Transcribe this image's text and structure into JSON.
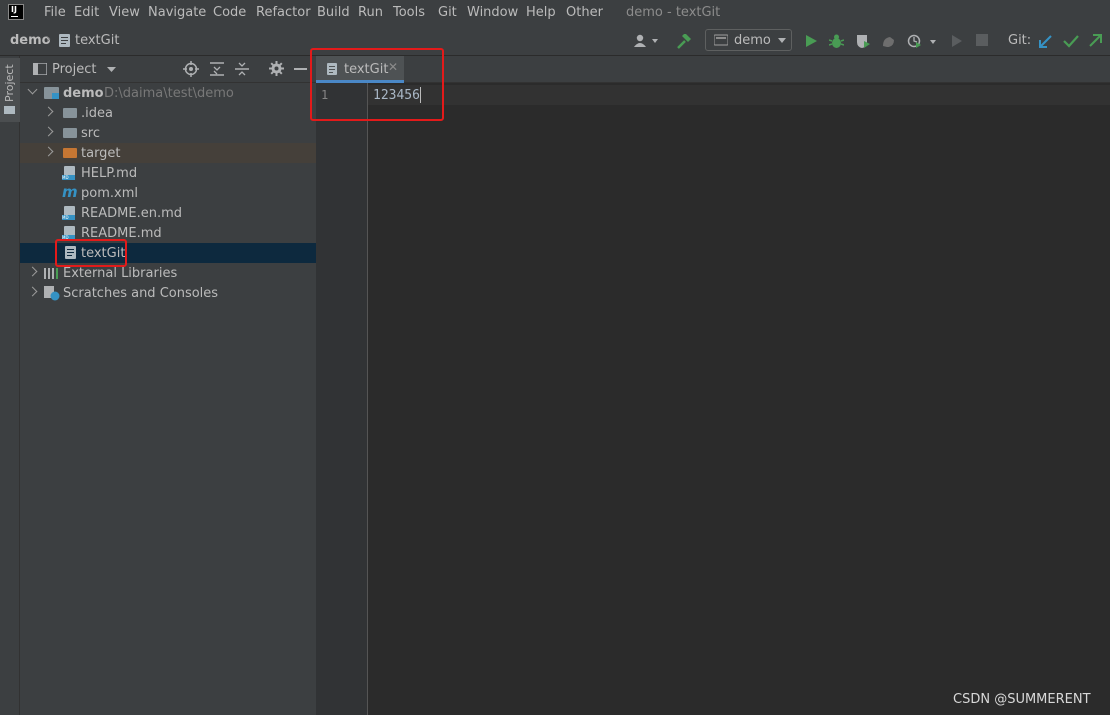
{
  "menu": {
    "items": [
      "File",
      "Edit",
      "View",
      "Navigate",
      "Code",
      "Refactor",
      "Build",
      "Run",
      "Tools",
      "Git",
      "Window",
      "Help",
      "Other"
    ],
    "window_title": "demo - textGit"
  },
  "app_logo_text": "IJ",
  "navbar": {
    "project": "demo",
    "file": "textGit",
    "run_config": "demo",
    "git_label": "Git:"
  },
  "stripe": {
    "project_label": "Project"
  },
  "project_panel": {
    "title": "Project",
    "root": {
      "name": "demo",
      "path": "D:\\daima\\test\\demo"
    },
    "items": [
      {
        "label": ".idea",
        "type": "folder"
      },
      {
        "label": "src",
        "type": "folder"
      },
      {
        "label": "target",
        "type": "folder-excluded"
      },
      {
        "label": "HELP.md",
        "type": "markdown"
      },
      {
        "label": "pom.xml",
        "type": "maven"
      },
      {
        "label": "README.en.md",
        "type": "markdown"
      },
      {
        "label": "README.md",
        "type": "markdown"
      },
      {
        "label": "textGit",
        "type": "text",
        "selected": true
      }
    ],
    "external_libraries": "External Libraries",
    "scratches": "Scratches and Consoles"
  },
  "editor": {
    "tab_label": "textGit",
    "line_number": "1",
    "code": "123456"
  },
  "watermark": "CSDN @SUMMERENT",
  "colors": {
    "accent": "#4a88c7",
    "highlight_box": "#e31a1a",
    "run_green": "#499c54",
    "git_blue": "#3592c4"
  }
}
